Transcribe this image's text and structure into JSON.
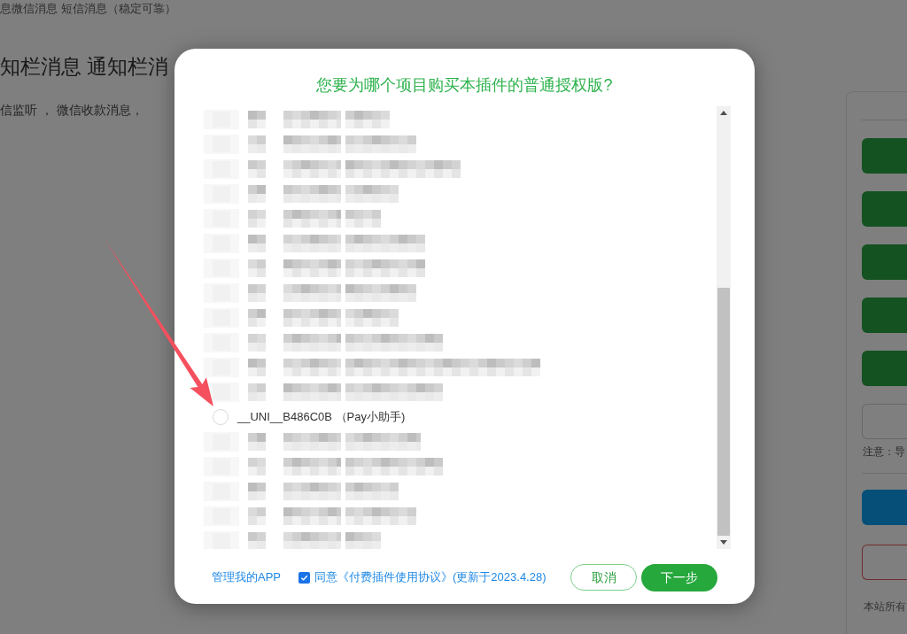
{
  "background_page": {
    "subtitle": "息微信消息 短信消息（稳定可靠）",
    "heading": "知栏消息 通知栏消",
    "description": "信监听 ， 微信收款消息，",
    "side_panel": {
      "items": [
        {
          "kind": "divider"
        },
        {
          "kind": "primary"
        },
        {
          "kind": "primary"
        },
        {
          "kind": "primary"
        },
        {
          "kind": "primary"
        },
        {
          "kind": "primary"
        },
        {
          "kind": "field"
        },
        {
          "kind": "note",
          "text": "注意：导"
        },
        {
          "kind": "divider"
        },
        {
          "kind": "info"
        },
        {
          "kind": "outline"
        },
        {
          "kind": "footer",
          "text": "本站所有"
        }
      ]
    }
  },
  "dialog": {
    "title": "您要为哪个项目购买本插件的普通授权版?",
    "projects": [
      {
        "kind": "redacted"
      },
      {
        "kind": "redacted"
      },
      {
        "kind": "redacted"
      },
      {
        "kind": "redacted"
      },
      {
        "kind": "redacted"
      },
      {
        "kind": "redacted"
      },
      {
        "kind": "redacted"
      },
      {
        "kind": "redacted"
      },
      {
        "kind": "redacted"
      },
      {
        "kind": "redacted"
      },
      {
        "kind": "redacted"
      },
      {
        "kind": "redacted"
      },
      {
        "kind": "option",
        "label": "__UNI__B486C0B （Pay小助手)",
        "selected": false
      },
      {
        "kind": "redacted"
      },
      {
        "kind": "redacted"
      },
      {
        "kind": "redacted"
      },
      {
        "kind": "redacted"
      },
      {
        "kind": "redacted"
      }
    ],
    "manage_link": "管理我的APP",
    "agreement": {
      "label": "同意《付费插件使用协议》(更新于2023.4.28)",
      "checked": true
    },
    "buttons": [
      {
        "kind": "secondary",
        "label": "取消"
      },
      {
        "kind": "primary",
        "label": "下一步"
      }
    ]
  }
}
